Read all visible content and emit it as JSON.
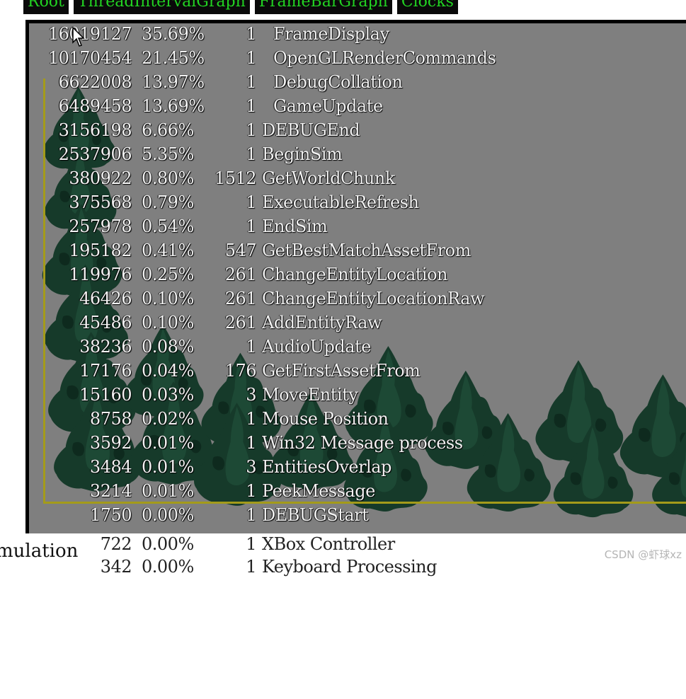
{
  "tabs": [
    "Root",
    "ThreadIntervalGraph",
    "FrameBarGraph",
    "Clocks"
  ],
  "rows": [
    {
      "count": "16019127",
      "pct": "35.69%",
      "hits": "1",
      "name": "FrameDisplay"
    },
    {
      "count": "10170454",
      "pct": "21.45%",
      "hits": "1",
      "name": "OpenGLRenderCommands"
    },
    {
      "count": "6622008",
      "pct": "13.97%",
      "hits": "1",
      "name": "DebugCollation"
    },
    {
      "count": "6489458",
      "pct": "13.69%",
      "hits": "1",
      "name": "GameUpdate"
    },
    {
      "count": "3156198",
      "pct": "6.66%",
      "hits": "1",
      "name": "DEBUGEnd"
    },
    {
      "count": "2537906",
      "pct": "5.35%",
      "hits": "1",
      "name": "BeginSim"
    },
    {
      "count": "380922",
      "pct": "0.80%",
      "hits": "1512",
      "name": "GetWorldChunk"
    },
    {
      "count": "375568",
      "pct": "0.79%",
      "hits": "1",
      "name": "ExecutableRefresh"
    },
    {
      "count": "257978",
      "pct": "0.54%",
      "hits": "1",
      "name": "EndSim"
    },
    {
      "count": "195182",
      "pct": "0.41%",
      "hits": "547",
      "name": "GetBestMatchAssetFrom"
    },
    {
      "count": "119976",
      "pct": "0.25%",
      "hits": "261",
      "name": "ChangeEntityLocation"
    },
    {
      "count": "46426",
      "pct": "0.10%",
      "hits": "261",
      "name": "ChangeEntityLocationRaw"
    },
    {
      "count": "45486",
      "pct": "0.10%",
      "hits": "261",
      "name": "AddEntityRaw"
    },
    {
      "count": "38236",
      "pct": "0.08%",
      "hits": "1",
      "name": "AudioUpdate"
    },
    {
      "count": "17176",
      "pct": "0.04%",
      "hits": "176",
      "name": "GetFirstAssetFrom"
    },
    {
      "count": "15160",
      "pct": "0.03%",
      "hits": "3",
      "name": "MoveEntity"
    },
    {
      "count": "8758",
      "pct": "0.02%",
      "hits": "1",
      "name": "Mouse Position"
    },
    {
      "count": "3592",
      "pct": "0.01%",
      "hits": "1",
      "name": "Win32 Message process"
    },
    {
      "count": "3484",
      "pct": "0.01%",
      "hits": "3",
      "name": "EntitiesOverlap"
    },
    {
      "count": "3214",
      "pct": "0.01%",
      "hits": "1",
      "name": "PeekMessage"
    },
    {
      "count": "1750",
      "pct": "0.00%",
      "hits": "1",
      "name": "DEBUGStart"
    }
  ],
  "outside_rows": [
    {
      "count": "722",
      "pct": "0.00%",
      "hits": "1",
      "name": "XBox Controller"
    },
    {
      "count": "342",
      "pct": "0.00%",
      "hits": "1",
      "name": "Keyboard Processing"
    }
  ],
  "side_label": "mulation",
  "watermark": "CSDN @虾球xz",
  "colors": {
    "tab_bg": "#0a0a0a",
    "tab_text": "#22d322",
    "panel_bg": "#7f7f7f",
    "frame": "#a49b1a",
    "tree": "#163a2a"
  }
}
